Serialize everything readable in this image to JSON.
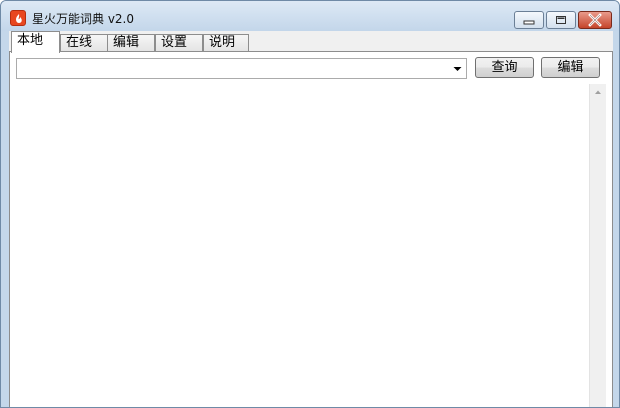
{
  "window": {
    "title": "星火万能词典 v2.0",
    "icon": "flame-icon"
  },
  "tabs": [
    {
      "label": "本地",
      "active": true
    },
    {
      "label": "在线",
      "active": false
    },
    {
      "label": "编辑",
      "active": false
    },
    {
      "label": "设置",
      "active": false
    },
    {
      "label": "说明",
      "active": false
    }
  ],
  "search": {
    "value": ""
  },
  "buttons": {
    "query": "查询",
    "edit": "编辑"
  },
  "result": {
    "text": ""
  },
  "colors": {
    "close_button": "#c5442a",
    "icon": "#e8471f"
  }
}
